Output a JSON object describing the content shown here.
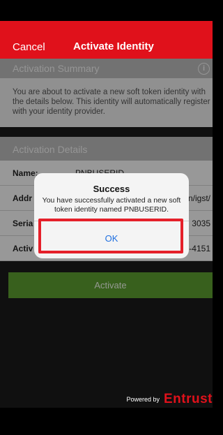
{
  "nav": {
    "cancel_label": "Cancel",
    "title": "Activate Identity"
  },
  "summary": {
    "header": "Activation Summary",
    "info_icon": "i",
    "text": "You are about to activate a new soft token identity with the details below. This identity will automatically register with your identity provider."
  },
  "details": {
    "header": "Activation Details",
    "rows": [
      {
        "label": "Name:",
        "value": "PNBUSERID"
      },
      {
        "label": "Addr",
        "value": "n/igst/"
      },
      {
        "label": "Seria",
        "value": "3035"
      },
      {
        "label": "Activ",
        "value": "-4151"
      }
    ]
  },
  "activate_button": "Activate",
  "footer": {
    "powered_by": "Powered by",
    "brand": "Entrust"
  },
  "alert": {
    "title": "Success",
    "message": "You have successfully activated a new soft token identity named PNBUSERID.",
    "ok_label": "OK"
  },
  "colors": {
    "brand_red": "#e0111b",
    "activate_green": "#5b9b2f",
    "ok_blue": "#1e6fe0",
    "highlight": "#e5202a"
  }
}
